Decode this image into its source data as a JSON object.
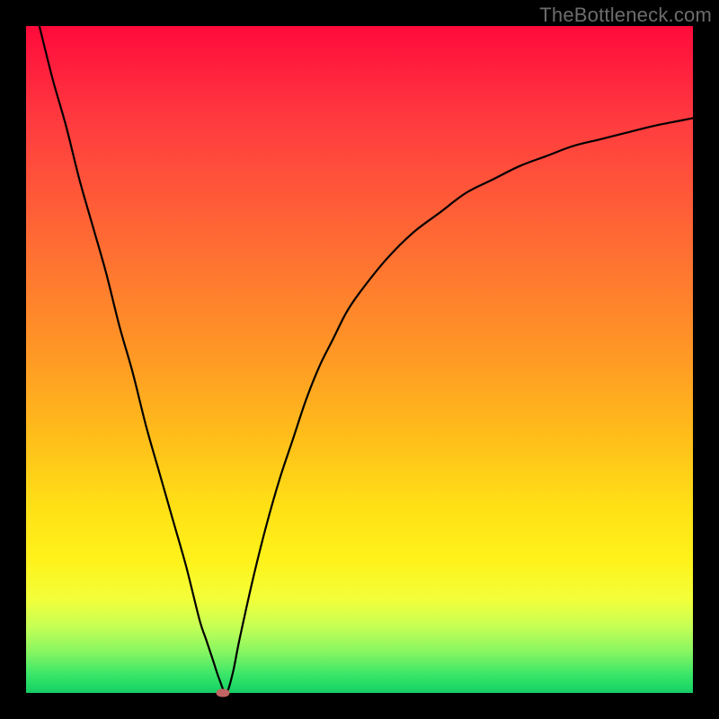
{
  "watermark": "TheBottleneck.com",
  "colors": {
    "frame": "#000000",
    "curve": "#000000",
    "marker": "#c06464"
  },
  "chart_data": {
    "type": "line",
    "title": "",
    "xlabel": "",
    "ylabel": "",
    "xlim": [
      0,
      100
    ],
    "ylim": [
      0,
      100
    ],
    "grid": false,
    "legend": false,
    "curve": {
      "x": [
        0,
        2,
        4,
        6,
        8,
        10,
        12,
        14,
        16,
        18,
        20,
        22,
        24,
        26,
        27,
        28,
        29,
        30,
        31,
        32,
        34,
        36,
        38,
        40,
        42,
        44,
        46,
        48,
        50,
        54,
        58,
        62,
        66,
        70,
        74,
        78,
        82,
        86,
        90,
        94,
        98,
        100
      ],
      "y": [
        108,
        100,
        92,
        85,
        77,
        70,
        63,
        55,
        48,
        40,
        33,
        26,
        19,
        11,
        8,
        5,
        2,
        0,
        3,
        8,
        17,
        25,
        32,
        38,
        44,
        49,
        53,
        57,
        60,
        65,
        69,
        72,
        75,
        77,
        79,
        80.5,
        82,
        83,
        84,
        85,
        85.8,
        86.2
      ]
    },
    "marker": {
      "x": 29.5,
      "y": 0
    },
    "background_gradient": {
      "direction": "vertical",
      "stops": [
        {
          "pos": 0,
          "color": "#ff0a3a"
        },
        {
          "pos": 50,
          "color": "#ff9a24"
        },
        {
          "pos": 80,
          "color": "#fff21a"
        },
        {
          "pos": 100,
          "color": "#18cc63"
        }
      ]
    }
  }
}
